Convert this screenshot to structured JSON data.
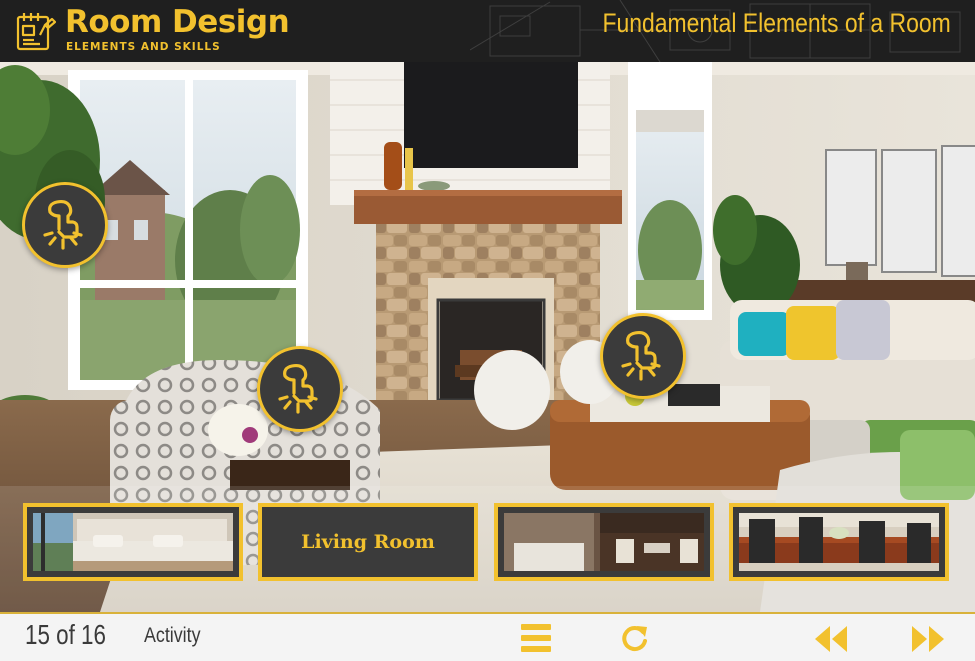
{
  "app": {
    "title": "Room Design",
    "subtitle": "ELEMENTS AND SKILLS"
  },
  "slide": {
    "title": "Fundamental Elements of a Room"
  },
  "hotspots": [
    {
      "name": "hotspot-window",
      "icon": "tap-icon"
    },
    {
      "name": "hotspot-armchair",
      "icon": "tap-icon"
    },
    {
      "name": "hotspot-ottoman",
      "icon": "tap-icon"
    }
  ],
  "thumbnails": [
    {
      "name": "thumbnail-bedroom",
      "label": "",
      "image": "bedroom-photo"
    },
    {
      "name": "thumbnail-living-room",
      "label": "Living Room",
      "image": ""
    },
    {
      "name": "thumbnail-bathroom",
      "label": "",
      "image": "bathroom-photo"
    },
    {
      "name": "thumbnail-dining-room",
      "label": "",
      "image": "dining-room-photo"
    }
  ],
  "footer": {
    "page_count": "15 of 16",
    "mode_label": "Activity",
    "menu_icon": "menu-icon",
    "replay_icon": "replay-icon",
    "prev_icon": "rewind-icon",
    "next_icon": "fast-forward-icon"
  },
  "colors": {
    "accent": "#f2c12e",
    "header_bg": "#1f1f1f",
    "hotspot_bg": "#3b3b3b",
    "footer_bg": "#f4f4f4",
    "footer_text": "#3a3a3a"
  }
}
